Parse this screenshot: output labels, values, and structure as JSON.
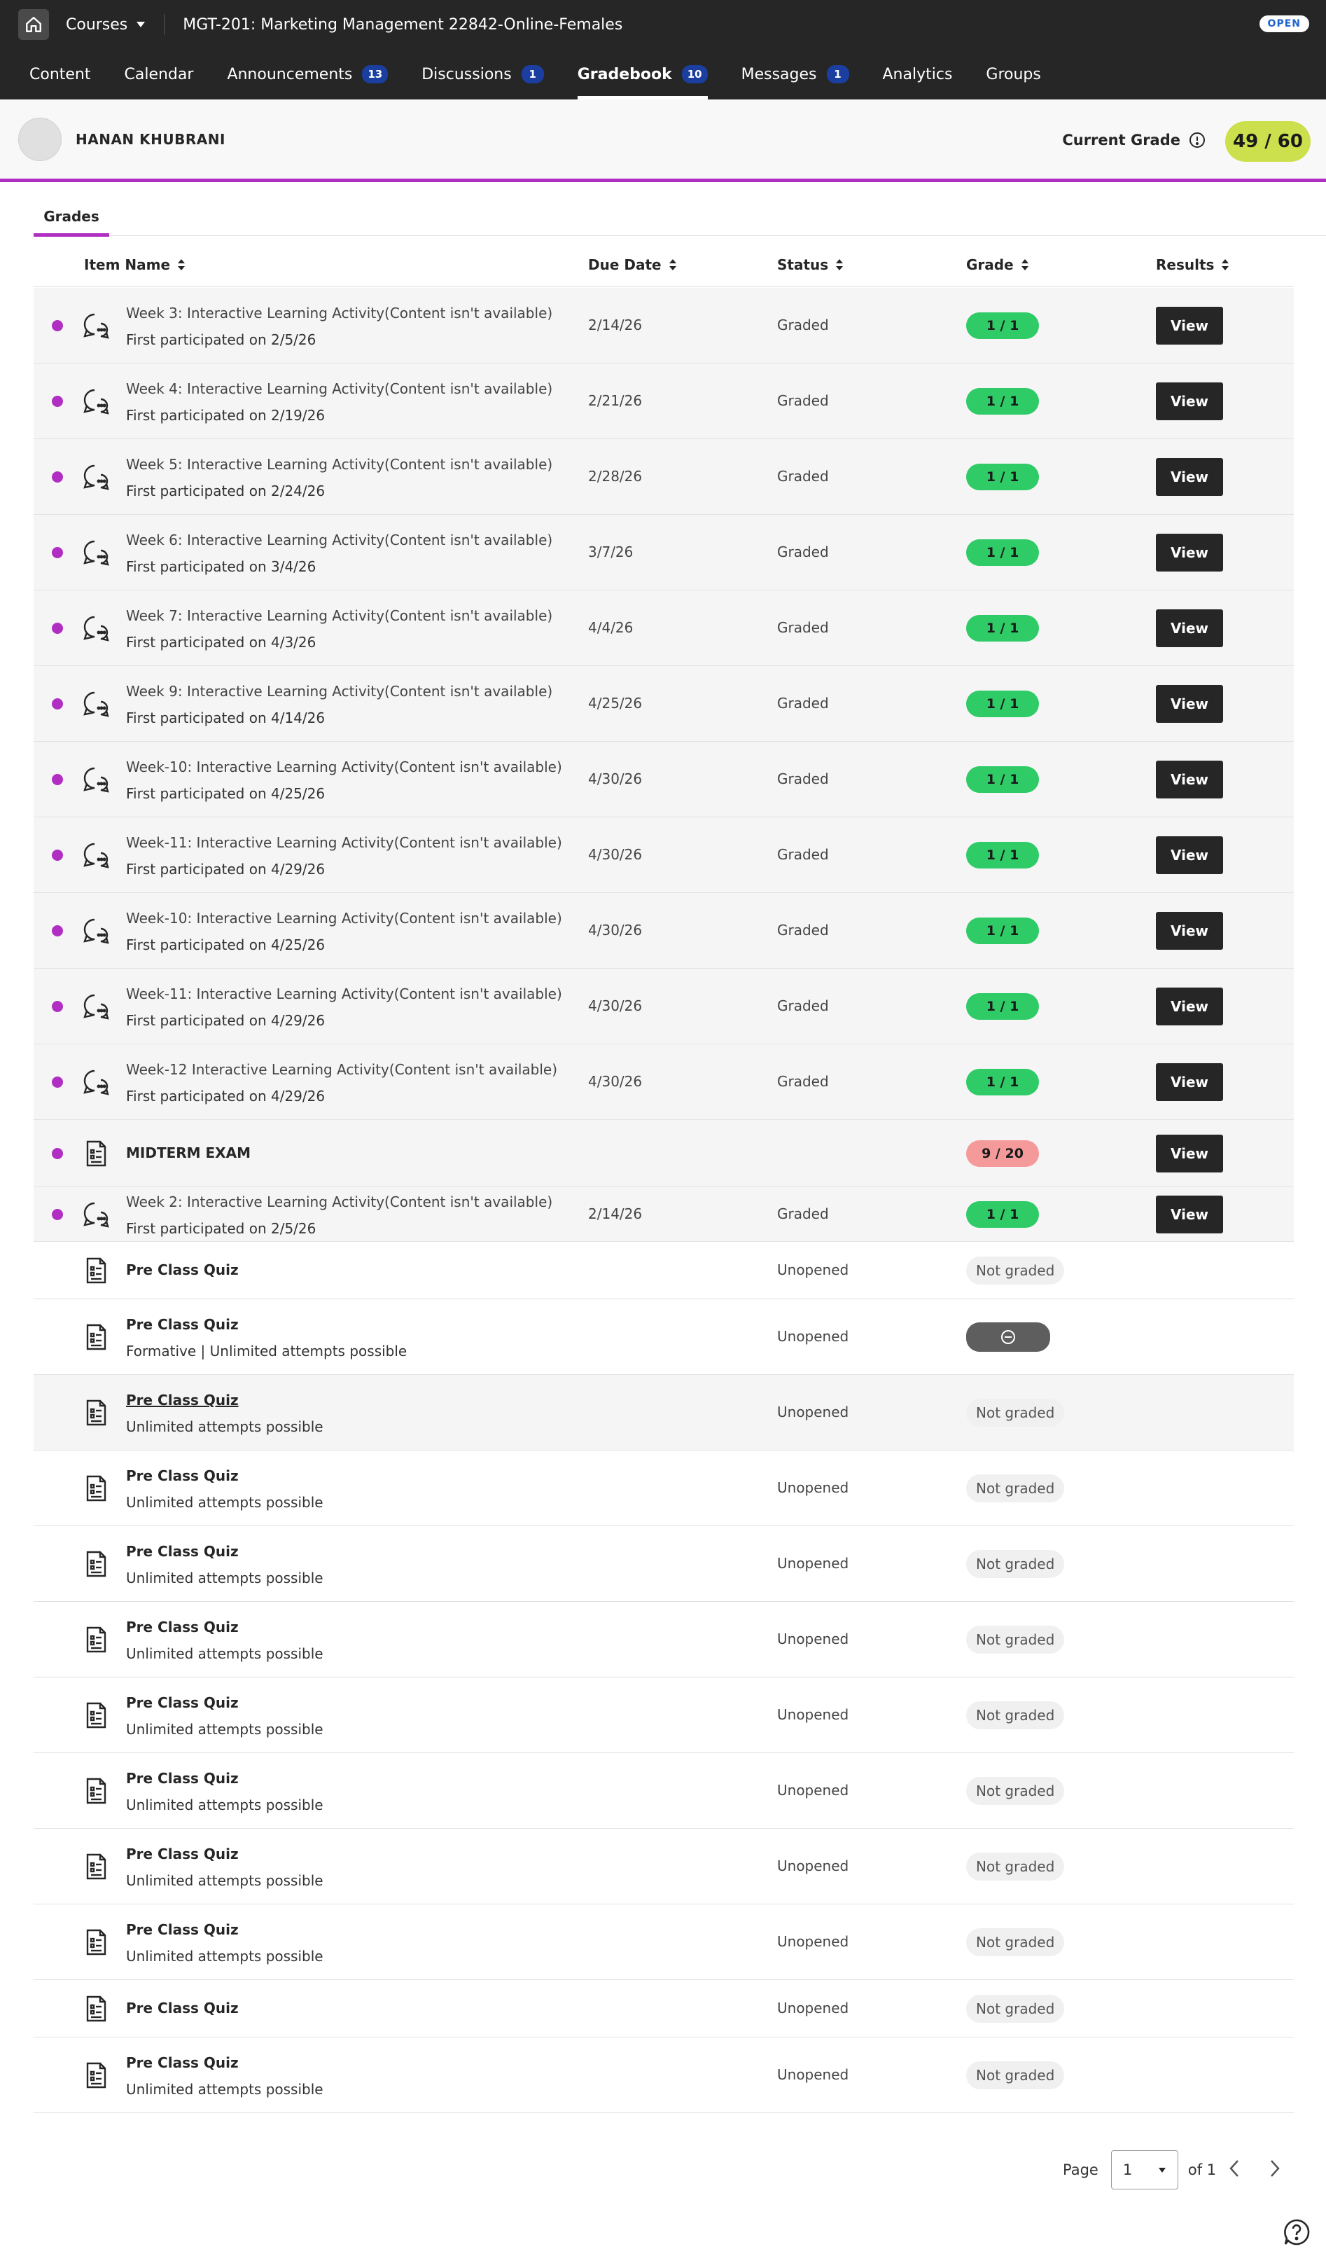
{
  "topbar": {
    "courses_label": "Courses",
    "course_title": "MGT-201: Marketing Management 22842-Online-Females",
    "status_badge": "OPEN"
  },
  "nav": [
    {
      "label": "Content"
    },
    {
      "label": "Calendar"
    },
    {
      "label": "Announcements",
      "badge": "13"
    },
    {
      "label": "Discussions",
      "badge": "1"
    },
    {
      "label": "Gradebook",
      "badge": "10",
      "active": true
    },
    {
      "label": "Messages",
      "badge": "1"
    },
    {
      "label": "Analytics"
    },
    {
      "label": "Groups"
    }
  ],
  "student": {
    "name": "HANAN KHUBRANI",
    "current_grade_label": "Current Grade",
    "current_grade": "49 / 60"
  },
  "tabs": {
    "grades": "Grades"
  },
  "columns": {
    "item_name": "Item Name",
    "due_date": "Due Date",
    "status": "Status",
    "grade": "Grade",
    "results": "Results"
  },
  "rows": [
    {
      "title": "Week 3: Interactive Learning Activity(Content isn't available)",
      "sub": "First participated on 2/5/26",
      "due": "2/14/26",
      "status": "Graded",
      "grade": "1 / 1",
      "action": "View",
      "icon": "discussion-icon"
    },
    {
      "title": "Week 4: Interactive Learning Activity(Content isn't available)",
      "sub": "First participated on 2/19/26",
      "due": "2/21/26",
      "status": "Graded",
      "grade": "1 / 1",
      "action": "View",
      "icon": "discussion-icon"
    },
    {
      "title": "Week  5: Interactive Learning Activity(Content isn't available)",
      "sub": "First participated on 2/24/26",
      "due": "2/28/26",
      "status": "Graded",
      "grade": "1 / 1",
      "action": "View",
      "icon": "discussion-icon"
    },
    {
      "title": "Week 6: Interactive Learning Activity(Content isn't available)",
      "sub": "First participated on 3/4/26",
      "due": "3/7/26",
      "status": "Graded",
      "grade": "1 / 1",
      "action": "View",
      "icon": "discussion-icon"
    },
    {
      "title": "Week 7: Interactive Learning Activity(Content isn't available)",
      "sub": "First participated on 4/3/26",
      "due": "4/4/26",
      "status": "Graded",
      "grade": "1 / 1",
      "action": "View",
      "icon": "discussion-icon"
    },
    {
      "title": "Week 9: Interactive Learning Activity(Content isn't available)",
      "sub": "First participated on 4/14/26",
      "due": "4/25/26",
      "status": "Graded",
      "grade": "1 / 1",
      "action": "View",
      "icon": "discussion-icon"
    },
    {
      "title": "Week-10: Interactive Learning Activity(Content isn't available)",
      "sub": "First participated on 4/25/26",
      "due": "4/30/26",
      "status": "Graded",
      "grade": "1 / 1",
      "action": "View",
      "icon": "discussion-icon"
    },
    {
      "title": "Week-11: Interactive Learning Activity(Content isn't available)",
      "sub": "First participated on 4/29/26",
      "due": "4/30/26",
      "status": "Graded",
      "grade": "1 / 1",
      "action": "View",
      "icon": "discussion-icon"
    },
    {
      "title": "Week-10: Interactive Learning Activity(Content isn't available)",
      "sub": "First participated on 4/25/26",
      "due": "4/30/26",
      "status": "Graded",
      "grade": "1 / 1",
      "action": "View",
      "icon": "discussion-icon"
    },
    {
      "title": "Week-11: Interactive Learning Activity(Content isn't available)",
      "sub": "First participated on 4/29/26",
      "due": "4/30/26",
      "status": "Graded",
      "grade": "1 / 1",
      "action": "View",
      "icon": "discussion-icon"
    },
    {
      "title": "Week-12 Interactive Learning Activity(Content isn't available)",
      "sub": "First participated on 4/29/26",
      "due": "4/30/26",
      "status": "Graded",
      "grade": "1 / 1",
      "action": "View",
      "icon": "discussion-icon"
    },
    {
      "title": "MIDTERM EXAM",
      "sub": "",
      "due": "",
      "status": "",
      "grade": "9 / 20",
      "action": "View",
      "icon": "test-icon"
    },
    {
      "title": "Week 2: Interactive Learning Activity(Content isn't available)",
      "sub": "First participated on 2/5/26",
      "due": "2/14/26",
      "status": "Graded",
      "grade": "1 / 1",
      "action": "View",
      "icon": "discussion-icon"
    },
    {
      "title": "Pre Class Quiz",
      "sub": "",
      "status": "Unopened",
      "grade": "Not graded",
      "icon": "test-icon"
    },
    {
      "title": "Pre Class Quiz",
      "sub": "Formative | Unlimited attempts possible",
      "status": "Unopened",
      "grade": "",
      "icon": "test-icon"
    },
    {
      "title": "Pre Class Quiz",
      "sub": "Unlimited attempts possible",
      "status": "Unopened",
      "grade": "Not graded",
      "icon": "test-icon"
    },
    {
      "title": "Pre Class Quiz",
      "sub": "Unlimited attempts possible",
      "status": "Unopened",
      "grade": "Not graded",
      "icon": "test-icon"
    },
    {
      "title": "Pre Class Quiz",
      "sub": "Unlimited attempts possible",
      "status": "Unopened",
      "grade": "Not graded",
      "icon": "test-icon"
    },
    {
      "title": "Pre Class Quiz",
      "sub": "Unlimited attempts possible",
      "status": "Unopened",
      "grade": "Not graded",
      "icon": "test-icon"
    },
    {
      "title": "Pre Class Quiz",
      "sub": "Unlimited attempts possible",
      "status": "Unopened",
      "grade": "Not graded",
      "icon": "test-icon"
    },
    {
      "title": "Pre Class Quiz",
      "sub": "Unlimited attempts possible",
      "status": "Unopened",
      "grade": "Not graded",
      "icon": "test-icon"
    },
    {
      "title": "Pre Class Quiz",
      "sub": "Unlimited attempts possible",
      "status": "Unopened",
      "grade": "Not graded",
      "icon": "test-icon"
    },
    {
      "title": "Pre Class Quiz",
      "sub": "Unlimited attempts possible",
      "status": "Unopened",
      "grade": "Not graded",
      "icon": "test-icon"
    },
    {
      "title": "Pre Class Quiz",
      "sub": "",
      "status": "Unopened",
      "grade": "Not graded",
      "icon": "test-icon"
    },
    {
      "title": "Pre Class Quiz",
      "sub": "Unlimited attempts possible",
      "status": "Unopened",
      "grade": "Not graded",
      "icon": "test-icon"
    }
  ],
  "pagination": {
    "page_label": "Page",
    "current": "1",
    "of_label": "of 1"
  },
  "colors": {
    "accent": "#b02fc2",
    "graded_green": "#2ecb67",
    "low_grade_red": "#f59a9a",
    "current_grade_bg": "#cbe04c",
    "dark": "#262626"
  }
}
